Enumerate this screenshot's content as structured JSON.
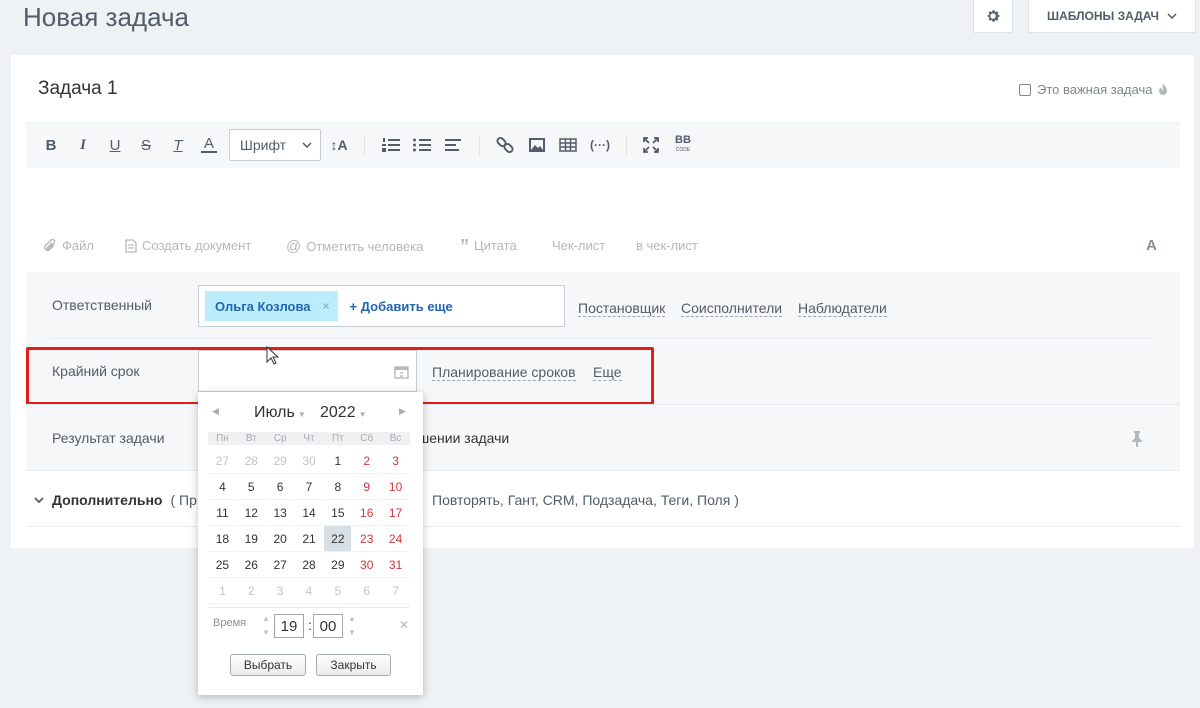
{
  "page_title": "Новая задача",
  "header": {
    "templates_label": "ШАБЛОНЫ ЗАДАЧ",
    "settings_icon": "gear-icon"
  },
  "task": {
    "title": "Задача 1",
    "important_label": "Это важная задача"
  },
  "toolbar": {
    "font_label": "Шрифт",
    "font_size_label": "↕A",
    "bold": "B",
    "italic": "I",
    "underline": "U",
    "strike": "S",
    "clear": "T",
    "color": "A"
  },
  "attach_bar": {
    "file": "Файл",
    "create_doc": "Создать документ",
    "mention": "Отметить человека",
    "quote": "Цитата",
    "checklist": "Чек-лист",
    "to_checklist": "в чек-лист",
    "font_toggle": "A"
  },
  "responsible": {
    "label": "Ответственный",
    "person": "Ольга Козлова",
    "remove": "×",
    "add_more": "+ Добавить еще",
    "roles": [
      "Постановщик",
      "Соисполнители",
      "Наблюдатели"
    ]
  },
  "deadline": {
    "label": "Крайний срок",
    "value": "",
    "planning_link": "Планирование сроков",
    "more_link": "Еще"
  },
  "result": {
    "label": "Результат задачи",
    "text": "шении задачи"
  },
  "additional": {
    "label": "Дополнительно",
    "open_paren": "( Пр",
    "items": "Повторять,  Гант,  CRM,  Подзадача,  Теги,  Поля )"
  },
  "calendar": {
    "month": "Июль",
    "year": "2022",
    "weekdays": [
      "Пн",
      "Вт",
      "Ср",
      "Чт",
      "Пт",
      "Сб",
      "Вс"
    ],
    "weeks": [
      [
        "27",
        "28",
        "29",
        "30",
        "1",
        "2",
        "3"
      ],
      [
        "4",
        "5",
        "6",
        "7",
        "8",
        "9",
        "10"
      ],
      [
        "11",
        "12",
        "13",
        "14",
        "15",
        "16",
        "17"
      ],
      [
        "18",
        "19",
        "20",
        "21",
        "22",
        "23",
        "24"
      ],
      [
        "25",
        "26",
        "27",
        "28",
        "29",
        "30",
        "31"
      ],
      [
        "1",
        "2",
        "3",
        "4",
        "5",
        "6",
        "7"
      ]
    ],
    "selected_day": "22",
    "time_label": "Время",
    "hours": "19",
    "minutes": "00",
    "select_button": "Выбрать",
    "close_button": "Закрыть"
  }
}
